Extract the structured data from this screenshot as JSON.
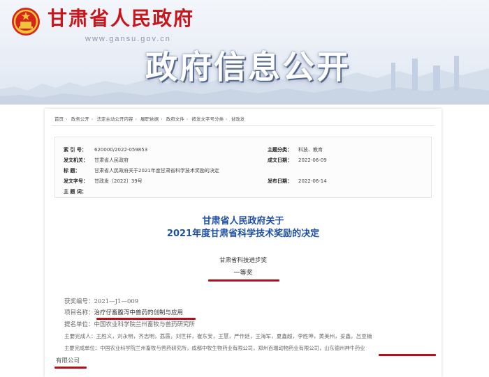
{
  "header": {
    "site_title": "甘肃省人民政府",
    "site_url": "www.gansu.gov.cn",
    "banner_title": "政府信息公开"
  },
  "breadcrumb": [
    "首页",
    "政务公开",
    "法定主动公开内容",
    "履职依据",
    "政府文件",
    "按发文字号分类",
    "甘政发"
  ],
  "meta": {
    "index_label": "索 引 号：",
    "index_value": "620000/2022-059853",
    "topic_label": "主题分类：",
    "topic_value": "科技、教育",
    "issuer_label": "发文机关：",
    "issuer_value": "甘肃省人民政府",
    "date_label": "成文日期：",
    "date_value": "2022-06-09",
    "title_label": "标    题：",
    "title_value": "甘肃省人民政府关于2021年度甘肃省科学技术奖励的决定",
    "docno_label": "发文字号：",
    "docno_value": "甘政发〔2022〕39号",
    "publish_label": "发布日期：",
    "publish_value": "2022-06-14",
    "keywords_label": "主 题 词："
  },
  "document": {
    "title_line1": "甘肃省人民政府关于",
    "title_line2": "2021年度甘肃省科学技术奖励的决定",
    "award_name": "甘肃省科技进步奖",
    "award_grade": "一等奖"
  },
  "award_entry": {
    "number_label": "获奖编号：",
    "number_value": "2021—J1—009",
    "project_label": "项目名称：",
    "project_value": "治疗仔畜腹泻中兽药的创制与应用",
    "nominator_label": "提名单位：",
    "nominator_value": "中国农业科学院兰州畜牧与兽药研究所",
    "people_label": "主要完成人：",
    "people_value": "王胜义，刘永明，齐志明，荔霞，刘世祥，崔东安，王慧，严作廷，王海军，夏鑫超，李胜坤，黄美州，妥鑫，吕亚楠",
    "orgs_label": "主要完成单位：",
    "orgs_value": "中国农业科学院兰州畜牧与兽药研究所，成都中牧生物药业有限公司，郑州百瑞动物药业有限公司，山东德州神牛药业",
    "orgs_tail": "有限公司"
  },
  "colors": {
    "brand_red": "#c8161d",
    "title_blue": "#1f4fa3",
    "underline_red": "#b0111a"
  }
}
